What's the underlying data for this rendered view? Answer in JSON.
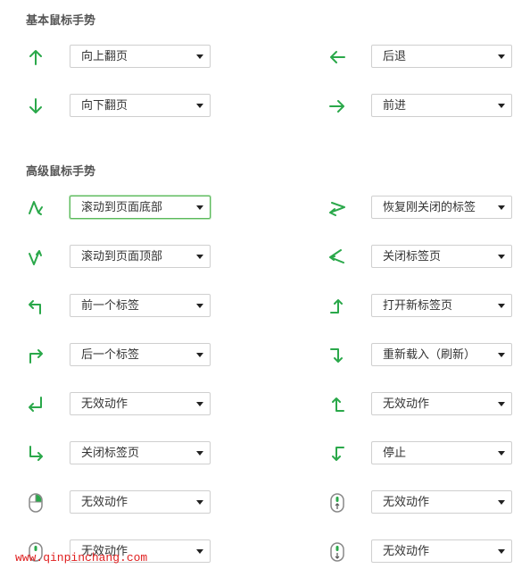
{
  "basic": {
    "title": "基本鼠标手势",
    "rows": [
      {
        "left": {
          "icon": "arrow-up-icon",
          "value": "向上翻页"
        },
        "right": {
          "icon": "arrow-left-icon",
          "value": "后退"
        }
      },
      {
        "left": {
          "icon": "arrow-down-icon",
          "value": "向下翻页"
        },
        "right": {
          "icon": "arrow-right-icon",
          "value": "前进"
        }
      }
    ]
  },
  "advanced": {
    "title": "高级鼠标手势",
    "rows": [
      {
        "left": {
          "icon": "zigzag-down-icon",
          "value": "滚动到页面底部"
        },
        "right": {
          "icon": "zigzag-left-icon",
          "value": "恢复刚关闭的标签"
        }
      },
      {
        "left": {
          "icon": "zigzag-up-icon",
          "value": "滚动到页面顶部"
        },
        "right": {
          "icon": "zigzag-left-alt-icon",
          "value": "关闭标签页"
        }
      },
      {
        "left": {
          "icon": "up-left-icon",
          "value": "前一个标签"
        },
        "right": {
          "icon": "right-up-icon",
          "value": "打开新标签页"
        }
      },
      {
        "left": {
          "icon": "up-right-icon",
          "value": "后一个标签"
        },
        "right": {
          "icon": "right-down-icon",
          "value": "重新载入（刷新）"
        }
      },
      {
        "left": {
          "icon": "down-left-icon",
          "value": "无效动作"
        },
        "right": {
          "icon": "left-up-icon",
          "value": "无效动作"
        }
      },
      {
        "left": {
          "icon": "down-right-icon",
          "value": "关闭标签页"
        },
        "right": {
          "icon": "left-down-icon",
          "value": "停止"
        }
      },
      {
        "left": {
          "icon": "mouse-right-click-icon",
          "value": "无效动作"
        },
        "right": {
          "icon": "mouse-wheel-up-icon",
          "value": "无效动作"
        }
      },
      {
        "left": {
          "icon": "mouse-middle-click-icon",
          "value": "无效动作"
        },
        "right": {
          "icon": "mouse-wheel-down-icon",
          "value": "无效动作"
        }
      }
    ]
  },
  "focused_select": "advanced.rows.0.left",
  "accent_color": "#2aa84a",
  "watermark": "www.qinpinchang.com"
}
